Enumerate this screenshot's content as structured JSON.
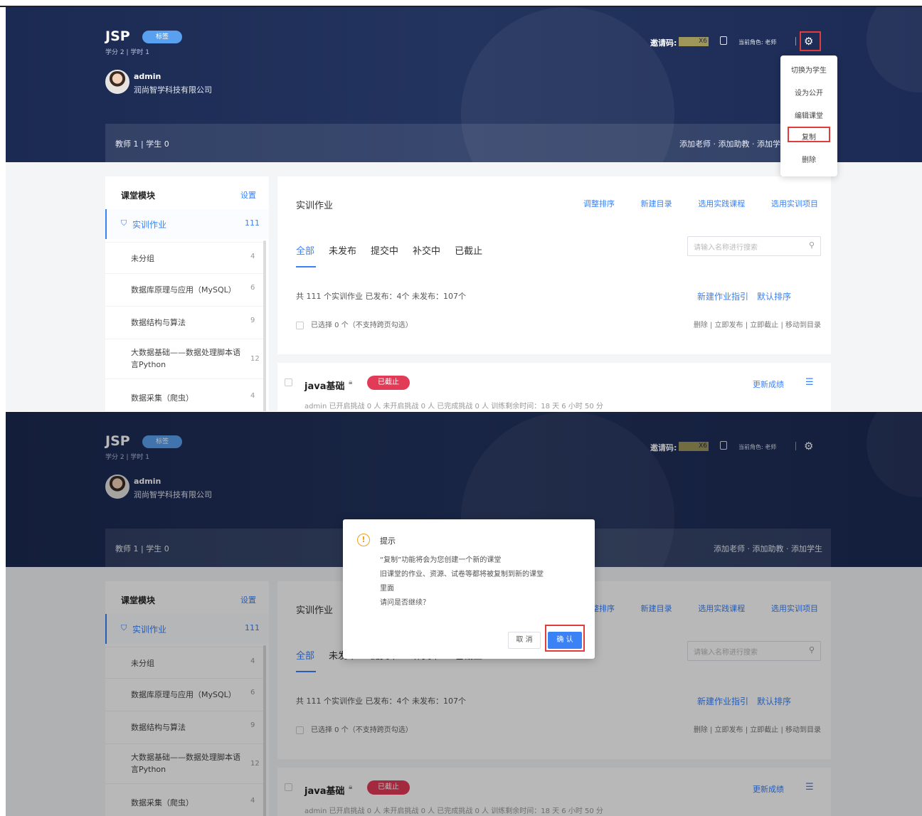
{
  "header": {
    "course_title": "JSP",
    "course_badge": "标签",
    "course_meta": "学分 2 | 学时 1",
    "user_name": "admin",
    "user_org": "润尚智学科技有限公司",
    "invite_label": "邀请码:",
    "invite_code": "X6",
    "role_text": "当前角色: 老师",
    "gear_icon": "gear-icon"
  },
  "stats": {
    "summary": "教师 1 | 学生 0",
    "actions": "添加老师 · 添加助教 · 添加学生"
  },
  "settings_menu": {
    "items": [
      "切换为学生",
      "设为公开",
      "编辑课堂",
      "复制",
      "删除"
    ],
    "highlighted": "复制"
  },
  "sidebar": {
    "title": "课堂模块",
    "set_label": "设置",
    "active": {
      "icon": "shield-icon",
      "label": "实训作业",
      "count": "111"
    },
    "items": [
      {
        "label": "未分组",
        "count": "4"
      },
      {
        "label": "数据库原理与应用（MySQL）",
        "count": "6"
      },
      {
        "label": "数据结构与算法",
        "count": "9"
      },
      {
        "label": "大数据基础——数据处理脚本语言Python",
        "count": "12"
      },
      {
        "label": "数据采集（爬虫）",
        "count": "4"
      }
    ]
  },
  "main": {
    "title": "实训作业",
    "links": [
      "调整排序",
      "新建目录",
      "选用实践课程",
      "选用实训项目"
    ],
    "tabs": [
      "全部",
      "未发布",
      "提交中",
      "补交中",
      "已截止"
    ],
    "search_placeholder": "请输入名称进行搜索",
    "summary": "共 111 个实训作业  已发布：4个  未发布：107个",
    "links2": [
      "新建作业指引",
      "默认排序"
    ],
    "selected_text": "已选择 0 个（不支持跨页勾选）",
    "batch_actions": "删除 | 立即发布 | 立即截止 | 移动到目录"
  },
  "card": {
    "title": "java基础",
    "badge": "已截止",
    "actions": "更新成绩",
    "meta": "admin  已开启挑战 0 人  未开启挑战 0 人  已完成挑战 0 人  训练剩余时间：18 天 6 小时 50 分"
  },
  "modal": {
    "title": "提示",
    "lines": [
      "“复制”功能将会为您创建一个新的课堂",
      "旧课堂的作业、资源、试卷等都将被复制到新的课堂",
      "里面",
      "请问是否继续？"
    ],
    "cancel": "取 消",
    "confirm": "确 认"
  },
  "colors": {
    "accent": "#3b82f6",
    "hero": "#1b2a52",
    "danger": "#e23b57",
    "highlight": "#e03c3c"
  }
}
